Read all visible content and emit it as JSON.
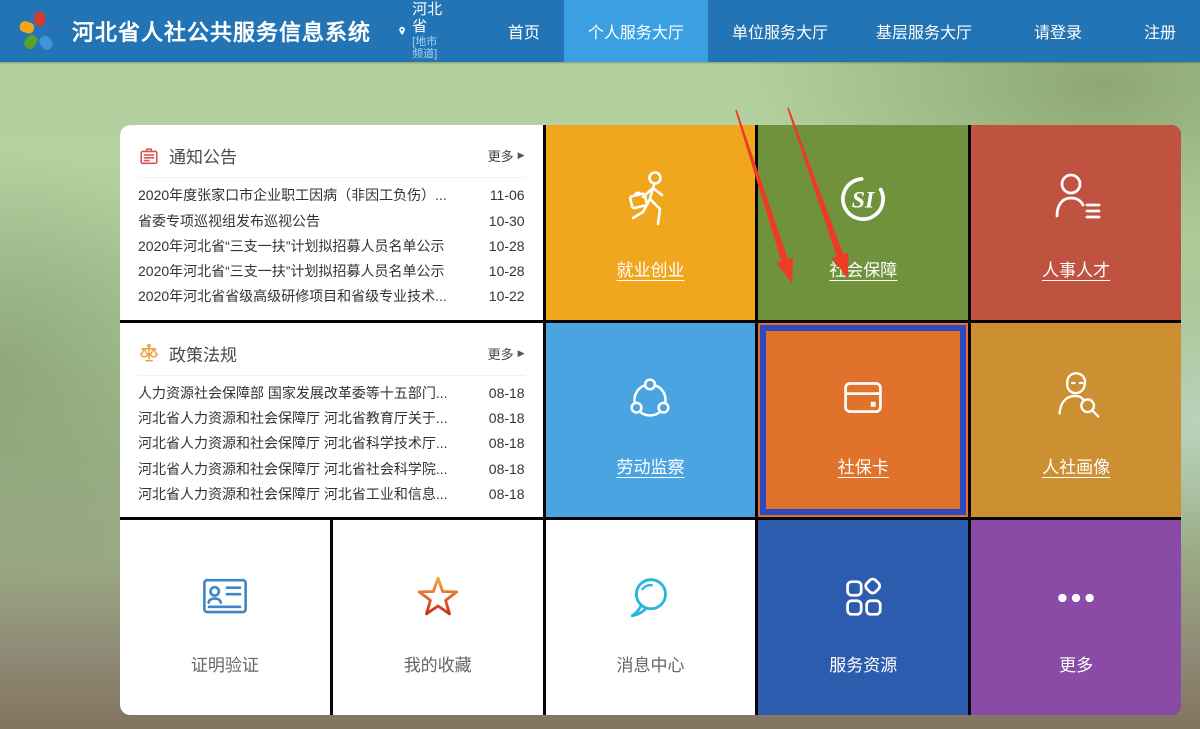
{
  "header": {
    "title": "河北省人社公共服务信息系统",
    "location": {
      "name": "河北省",
      "channel": "[地市频道]"
    },
    "nav": [
      {
        "label": "首页",
        "active": false
      },
      {
        "label": "个人服务大厅",
        "active": true
      },
      {
        "label": "单位服务大厅",
        "active": false
      },
      {
        "label": "基层服务大厅",
        "active": false
      },
      {
        "label": "请登录",
        "active": false
      },
      {
        "label": "注册",
        "active": false
      }
    ]
  },
  "panels": [
    {
      "title": "通知公告",
      "more_label": "更多",
      "icon": "notice-icon",
      "items": [
        {
          "text": "2020年度张家口市企业职工因病（非因工负伤）...",
          "date": "11-06"
        },
        {
          "text": "省委专项巡视组发布巡视公告",
          "date": "10-30"
        },
        {
          "text": "2020年河北省“三支一扶”计划拟招募人员名单公示",
          "date": "10-28"
        },
        {
          "text": "2020年河北省“三支一扶”计划拟招募人员名单公示",
          "date": "10-28"
        },
        {
          "text": "2020年河北省省级高级研修项目和省级专业技术...",
          "date": "10-22"
        }
      ]
    },
    {
      "title": "政策法规",
      "more_label": "更多",
      "icon": "law-scales-icon",
      "items": [
        {
          "text": "人力资源社会保障部 国家发展改革委等十五部门...",
          "date": "08-18"
        },
        {
          "text": "河北省人力资源和社会保障厅 河北省教育厅关于...",
          "date": "08-18"
        },
        {
          "text": "河北省人力资源和社会保障厅 河北省科学技术厅...",
          "date": "08-18"
        },
        {
          "text": "河北省人力资源和社会保障厅 河北省社会科学院...",
          "date": "08-18"
        },
        {
          "text": "河北省人力资源和社会保障厅 河北省工业和信息...",
          "date": "08-18"
        }
      ]
    }
  ],
  "tiles": [
    {
      "label": "就业创业",
      "icon": "employment-icon",
      "color": "#f0a71d"
    },
    {
      "label": "社会保障",
      "icon": "social-insurance-icon",
      "color": "#71923d"
    },
    {
      "label": "人事人才",
      "icon": "personnel-icon",
      "color": "#c05340"
    },
    {
      "label": "劳动监察",
      "icon": "labor-supervision-icon",
      "color": "#4aa4e1"
    },
    {
      "label": "社保卡",
      "icon": "social-security-card-icon",
      "color": "#e0722c",
      "highlighted": true,
      "highlight_color": "#2e49c4"
    },
    {
      "label": "人社画像",
      "icon": "hr-portrait-icon",
      "color": "#cc8f32"
    },
    {
      "label": "证明验证",
      "icon": "certificate-verify-icon",
      "color": "#ffffff"
    },
    {
      "label": "我的收藏",
      "icon": "favorites-star-icon",
      "color": "#ffffff"
    },
    {
      "label": "消息中心",
      "icon": "message-center-icon",
      "color": "#ffffff"
    },
    {
      "label": "服务资源",
      "icon": "service-resources-icon",
      "color": "#2c5cad"
    },
    {
      "label": "更多",
      "icon": "more-dots-icon",
      "color": "#8a4ba6"
    }
  ],
  "annotations": {
    "arrow_color": "#ed3b26"
  }
}
